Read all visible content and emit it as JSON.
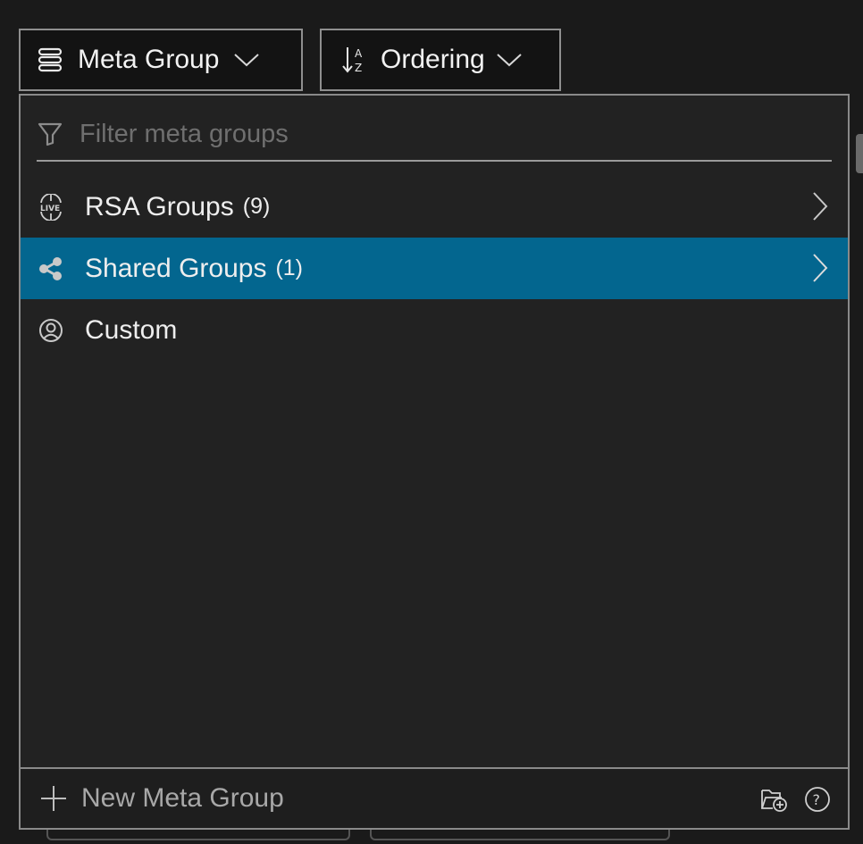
{
  "toolbar": {
    "meta_group": {
      "label": "Meta Group",
      "icon": "list-stack-icon"
    },
    "ordering": {
      "label": "Ordering",
      "icon": "sort-az-icon"
    }
  },
  "dropdown": {
    "filter": {
      "placeholder": "Filter meta groups",
      "value": "",
      "icon": "funnel-icon"
    },
    "items": [
      {
        "label": "RSA Groups",
        "count": "(9)",
        "icon": "live-globe-icon",
        "has_submenu": true,
        "selected": false
      },
      {
        "label": "Shared Groups",
        "count": "(1)",
        "icon": "share-icon",
        "has_submenu": true,
        "selected": true
      },
      {
        "label": "Custom",
        "count": "",
        "icon": "user-circle-icon",
        "has_submenu": false,
        "selected": false
      }
    ],
    "footer": {
      "new_label": "New Meta Group",
      "icons": [
        "plus-icon",
        "folder-add-icon",
        "help-circle-icon"
      ]
    }
  },
  "colors": {
    "selected_row": "#03668f",
    "panel_bg": "#222222",
    "border": "#8a8a8a",
    "placeholder": "#6f6f6f"
  }
}
